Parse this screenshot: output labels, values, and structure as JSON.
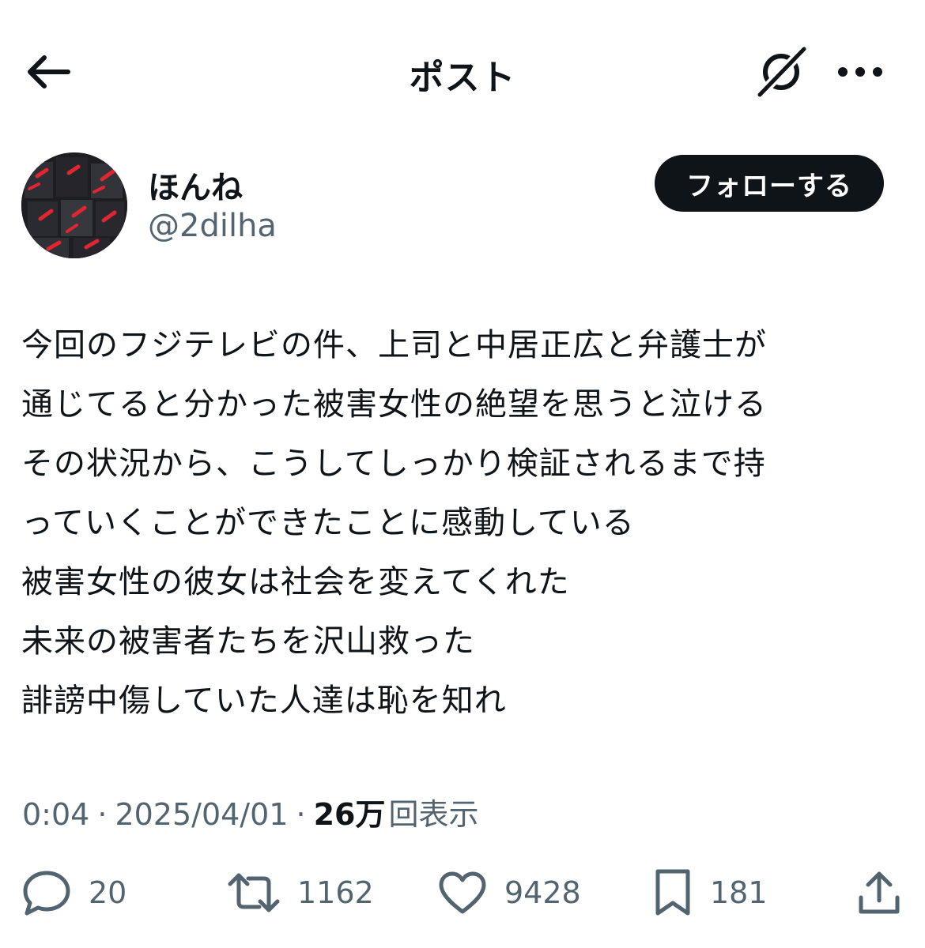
{
  "header": {
    "title": "ポスト",
    "back_icon": "arrow-left-icon",
    "grok_icon": "grok-icon",
    "more_icon": "more-horizontal-icon"
  },
  "author": {
    "display_name": "ほんね",
    "handle": "@2dilha",
    "follow_label": "フォローする"
  },
  "tweet": {
    "text": "今回のフジテレビの件、上司と中居正広と弁護士が\n通じてると分かった被害女性の絶望を思うと泣ける\nその状況から、こうしてしっかり検証されるまで持\nっていくことができたことに感動している\n被害女性の彼女は社会を変えてくれた\n未来の被害者たちを沢山救った\n誹謗中傷していた人達は恥を知れ"
  },
  "meta": {
    "time": "0:04",
    "separator": "·",
    "date": "2025/04/01",
    "views_count": "26万",
    "views_label": "回表示"
  },
  "actions": {
    "replies": "20",
    "reposts": "1162",
    "likes": "9428",
    "bookmarks": "181"
  },
  "colors": {
    "text": "#0f1419",
    "secondary": "#536471",
    "follow_bg": "#0f1419",
    "avatar_accent": "#e0262f"
  }
}
